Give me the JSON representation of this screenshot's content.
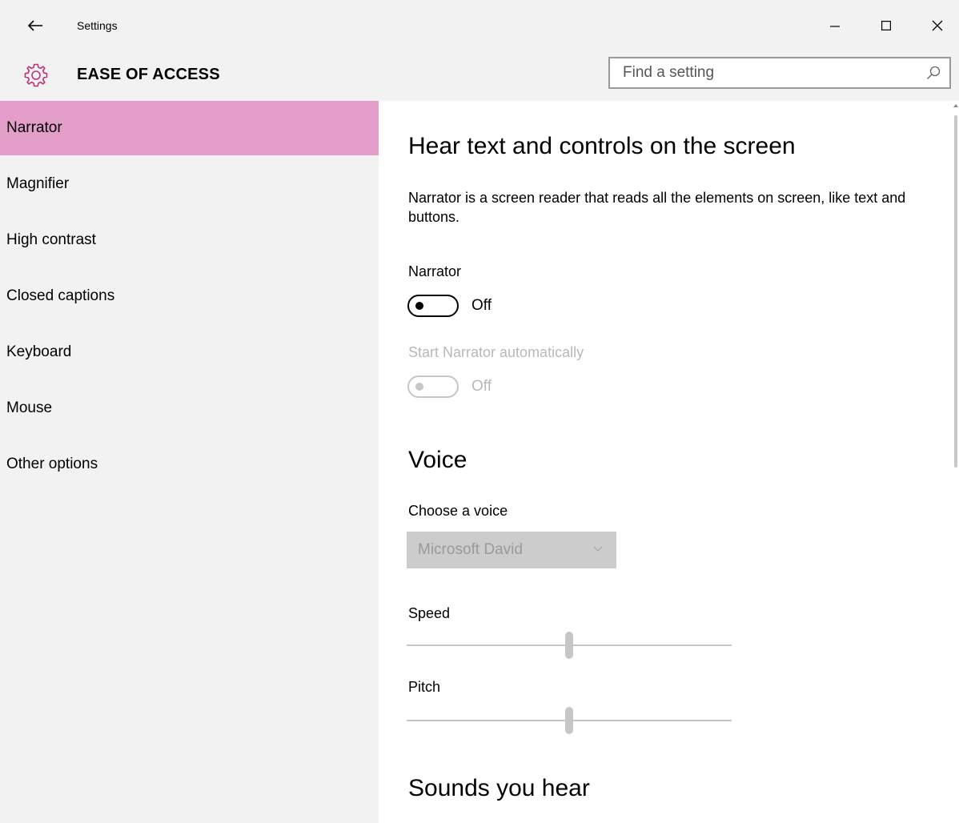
{
  "window": {
    "title": "Settings",
    "controls": {
      "minimize": "—",
      "maximize": "☐",
      "close": "✕"
    }
  },
  "header": {
    "section_title": "EASE OF ACCESS",
    "icon": "gear-icon",
    "search": {
      "placeholder": "Find a setting",
      "value": ""
    }
  },
  "sidebar": {
    "items": [
      {
        "label": "Narrator",
        "selected": true
      },
      {
        "label": "Magnifier",
        "selected": false
      },
      {
        "label": "High contrast",
        "selected": false
      },
      {
        "label": "Closed captions",
        "selected": false
      },
      {
        "label": "Keyboard",
        "selected": false
      },
      {
        "label": "Mouse",
        "selected": false
      },
      {
        "label": "Other options",
        "selected": false
      }
    ]
  },
  "main": {
    "heading": "Hear text and controls on the screen",
    "description": "Narrator is a screen reader that reads all the elements on screen, like text and buttons.",
    "narrator": {
      "label": "Narrator",
      "state": "Off"
    },
    "auto_start": {
      "label": "Start Narrator automatically",
      "state": "Off",
      "enabled": false
    },
    "voice": {
      "heading": "Voice",
      "choose_label": "Choose a voice",
      "selected_voice": "Microsoft David",
      "speed": {
        "label": "Speed",
        "level": 0.5
      },
      "pitch": {
        "label": "Pitch",
        "level": 0.5
      }
    },
    "sounds_heading": "Sounds you hear"
  },
  "colors": {
    "accent": "#e39ec9",
    "sidebar_bg": "#f2f2f2",
    "disabled": "#c6c6c6"
  }
}
